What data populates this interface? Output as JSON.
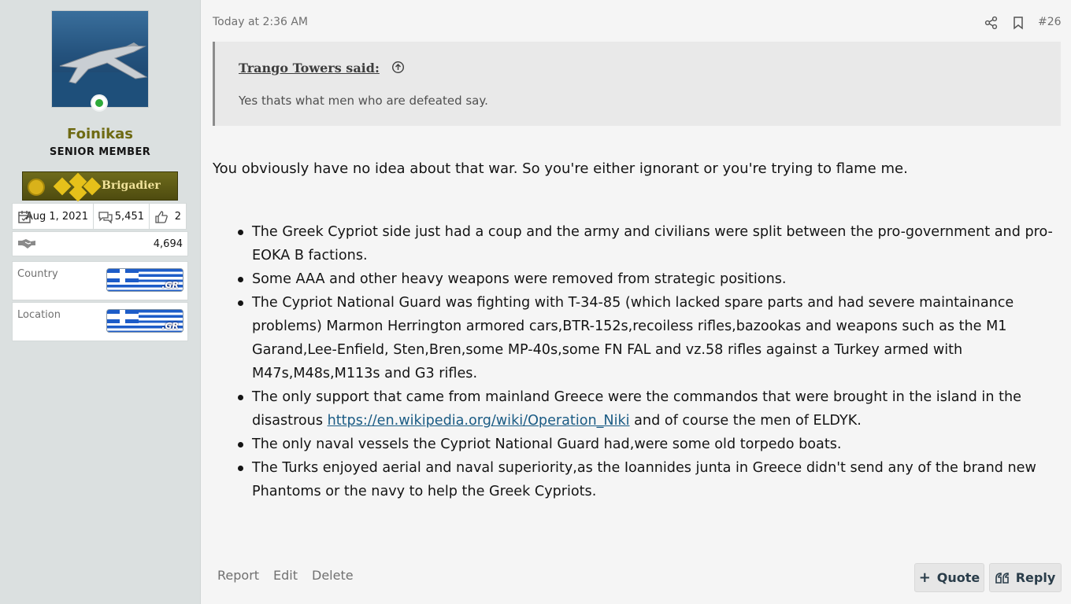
{
  "user": {
    "name": "Foinikas",
    "title": "SENIOR MEMBER",
    "rank": "Brigadier",
    "joined": "Aug 1, 2021",
    "messages": "5,451",
    "reactions": "2",
    "points": "4,694",
    "fields": [
      {
        "label": "Country",
        "flag_text": ".GR"
      },
      {
        "label": "Location",
        "flag_text": ".GR"
      }
    ]
  },
  "post": {
    "date": "Today at 2:36 AM",
    "number": "#26",
    "quote": {
      "author": "Trango Towers said:",
      "text": "Yes thats what men who are defeated say."
    },
    "intro": "You obviously have no idea about that war. So you're either ignorant or you're trying to flame me.",
    "bullets": [
      {
        "text": "The Greek Cypriot side just had a coup and the army and civilians were split between the pro-government and pro-EOKA B factions."
      },
      {
        "text": "Some AAA and other heavy weapons were removed from strategic positions."
      },
      {
        "text": "The Cypriot National Guard was fighting with T-34-85 (which lacked spare parts and had severe maintainance problems) Marmon Herrington armored cars,BTR-152s,recoiless rifles,bazookas and weapons such as the M1 Garand,Lee-Enfield, Sten,Bren,some MP-40s,some FN FAL and vz.58 rifles against a Turkey armed with M47s,M48s,M113s and G3 rifles."
      },
      {
        "before": "The only support that came from mainland Greece were the commandos that were brought in the island in the disastrous ",
        "link": "https://en.wikipedia.org/wiki/Operation_Niki",
        "after": " and of course the men of ELDYK."
      },
      {
        "text": "The only naval vessels the Cypriot National Guard had,were some old torpedo boats."
      },
      {
        "text": "The Turks enjoyed aerial and naval superiority,as the Ioannides junta in Greece didn't send any of the brand new Phantoms or the navy to help the Greek Cypriots."
      }
    ]
  },
  "actions": {
    "report": "Report",
    "edit": "Edit",
    "delete": "Delete",
    "quote": "Quote",
    "reply": "Reply"
  },
  "icons": {
    "share": "share-icon",
    "bookmark": "bookmark-icon",
    "calendar": "calendar-icon",
    "messages": "messages-icon",
    "reactions": "thumbs-up-icon",
    "points": "handshake-icon",
    "quote_jump": "arrow-up-circle-icon"
  },
  "colors": {
    "username": "#6e6a13",
    "online": "#2eaa3a",
    "link": "#1a5b84",
    "sidebar_bg": "#dbe0e0"
  }
}
